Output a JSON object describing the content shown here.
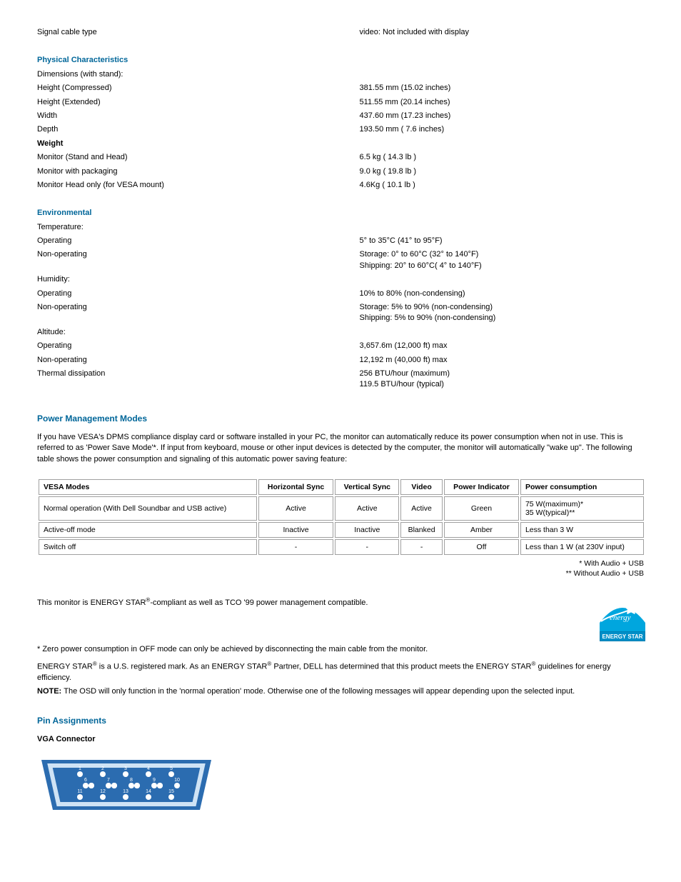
{
  "spec_rows": [
    [
      "Signal cable type",
      "video: Not included with display"
    ],
    [
      "section:Physical Characteristics",
      ""
    ],
    [
      "Dimensions (with stand):",
      ""
    ],
    [
      "Height (Compressed)",
      "381.55 mm (15.02 inches)"
    ],
    [
      "Height (Extended)",
      "511.55 mm (20.14 inches)"
    ],
    [
      "Width",
      "437.60 mm (17.23 inches)"
    ],
    [
      "Depth",
      "193.50 mm (  7.6 inches)"
    ],
    [
      "subheading:Weight",
      ""
    ],
    [
      "Monitor (Stand and Head)",
      "6.5 kg ( 14.3 lb )"
    ],
    [
      "Monitor with packaging",
      "9.0 kg ( 19.8 lb )"
    ],
    [
      "Monitor Head only (for VESA mount)",
      "4.6Kg ( 10.1 lb )"
    ],
    [
      "section:Environmental",
      ""
    ],
    [
      "Temperature:",
      ""
    ],
    [
      "Operating",
      "5° to 35°C (41° to 95°F)"
    ],
    [
      "Non-operating",
      "Storage: 0° to 60°C (32° to 140°F)\nShipping:  20° to 60°C(  4° to 140°F)"
    ],
    [
      "Humidity:",
      ""
    ],
    [
      "Operating",
      "10% to 80% (non-condensing)"
    ],
    [
      "Non-operating",
      "Storage: 5% to 90% (non-condensing)\nShipping: 5% to 90% (non-condensing)"
    ],
    [
      "Altitude:",
      ""
    ],
    [
      "Operating",
      "3,657.6m (12,000 ft) max"
    ],
    [
      "Non-operating",
      "12,192 m (40,000 ft) max"
    ],
    [
      "Thermal dissipation",
      "256 BTU/hour (maximum)\n119.5 BTU/hour (typical)"
    ]
  ],
  "section_header": "Power Management Modes",
  "pm_intro": "If you have VESA's DPMS compliance display card or software installed in your PC, the monitor can automatically reduce its power consumption when not in use. This is referred to as 'Power Save Mode'*. If input from keyboard, mouse or other input devices is detected by the computer, the monitor will automatically \"wake up\". The following table shows the power consumption and signaling of this automatic power saving feature:",
  "power_table": {
    "headers": [
      "VESA Modes",
      "Horizontal Sync",
      "Vertical Sync",
      "Video",
      "Power Indicator",
      "Power consumption"
    ],
    "rows": [
      [
        "Normal operation (With Dell Soundbar and USB active)",
        "Active",
        "Active",
        "Active",
        "Green",
        "75 W(maximum)*\n35 W(typical)**"
      ],
      [
        "Active-off mode",
        "Inactive",
        "Inactive",
        "Blanked",
        "Amber",
        "Less than 3 W"
      ],
      [
        "Switch off",
        "-",
        "-",
        "-",
        "Off",
        "Less than 1 W (at 230V input)"
      ]
    ]
  },
  "after_pm_table": "* With Audio + USB\n** Without Audio + USB",
  "energy_text": "This monitor is ENERGY STAR{sup}-compliant as well as TCO '99 power management compatible.",
  "energy_foot": "* Zero power consumption in OFF mode can only be achieved by disconnecting the main cable from the monitor.",
  "energy_brand": "ENERGY STAR{sup} is a U.S. registered mark. As an ENERGY STAR{sup} Partner, DELL has determined that this product meets the ENERGY STAR{sup} guidelines for energy efficiency.",
  "note_label": "NOTE: ",
  "note_text": "The OSD will only function in the 'normal operation' mode. Otherwise one of the following messages will appear depending upon the selected input.",
  "pin_heading": "Pin Assignments",
  "vga_heading": "VGA Connector"
}
